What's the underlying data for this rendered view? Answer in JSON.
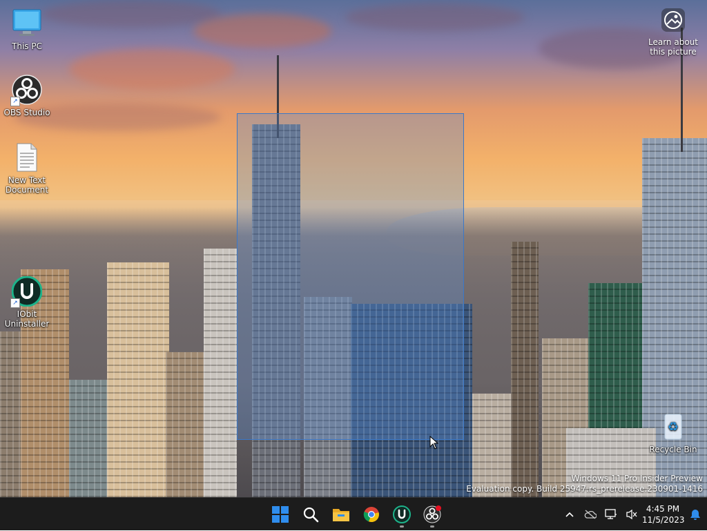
{
  "desktop": {
    "icons": [
      {
        "label": "This PC",
        "icon": "monitor-icon"
      },
      {
        "label": "OBS Studio",
        "icon": "obs-icon"
      },
      {
        "label": "New Text Document",
        "icon": "text-file-icon"
      },
      {
        "label": "IObit Uninstaller",
        "icon": "iobit-uninstaller-icon"
      },
      {
        "label": "Recycle Bin",
        "icon": "recycle-bin-icon"
      }
    ],
    "learn_about_picture": "Learn about this picture"
  },
  "watermark": {
    "line1": "Windows 11 Pro Insider Preview",
    "line2": "Evaluation copy. Build 25947.rs_prerelease.230901-1416"
  },
  "taskbar": {
    "pinned": [
      {
        "name": "start-button",
        "icon": "windows-logo-icon",
        "running": false
      },
      {
        "name": "search-button",
        "icon": "search-icon",
        "running": false
      },
      {
        "name": "file-explorer-button",
        "icon": "folder-icon",
        "running": false
      },
      {
        "name": "chrome-button",
        "icon": "chrome-icon",
        "running": false
      },
      {
        "name": "iobit-uninstaller-button",
        "icon": "iobit-uninstaller-icon",
        "running": true
      },
      {
        "name": "obs-studio-button",
        "icon": "obs-icon",
        "running": true
      }
    ],
    "tray": {
      "icons": [
        "chevron-up-icon",
        "onedrive-icon",
        "network-icon",
        "volume-muted-icon"
      ],
      "time": "4:45 PM",
      "date": "11/5/2023",
      "notification_icon": "bell-icon"
    }
  },
  "colors": {
    "taskbar_bg": "#1c1c1c",
    "selection_fill": "rgba(90,140,210,0.32)",
    "selection_border": "#3b78c8",
    "windows_blue": "#2f8ded",
    "iobit_green": "#1db38a"
  }
}
